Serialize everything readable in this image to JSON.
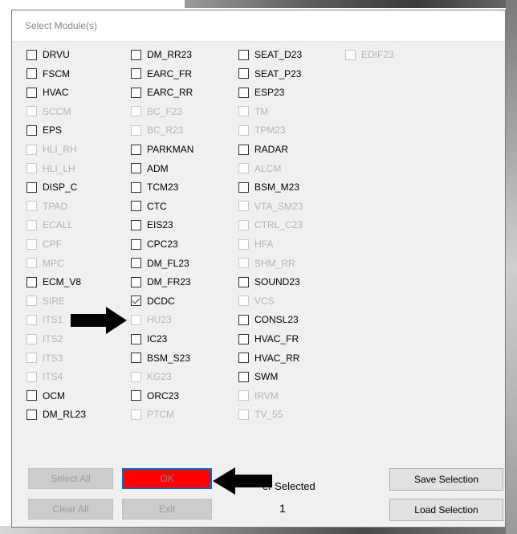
{
  "dialog": {
    "title": "Select Module(s)",
    "columns": [
      [
        {
          "label": "DRVU",
          "enabled": true,
          "checked": false
        },
        {
          "label": "FSCM",
          "enabled": true,
          "checked": false
        },
        {
          "label": "HVAC",
          "enabled": true,
          "checked": false
        },
        {
          "label": "SCCM",
          "enabled": false,
          "checked": false
        },
        {
          "label": "EPS",
          "enabled": true,
          "checked": false
        },
        {
          "label": "HLI_RH",
          "enabled": false,
          "checked": false
        },
        {
          "label": "HLI_LH",
          "enabled": false,
          "checked": false
        },
        {
          "label": "DISP_C",
          "enabled": true,
          "checked": false
        },
        {
          "label": "TPAD",
          "enabled": false,
          "checked": false
        },
        {
          "label": "ECALL",
          "enabled": false,
          "checked": false
        },
        {
          "label": "CPF",
          "enabled": false,
          "checked": false
        },
        {
          "label": "MPC",
          "enabled": false,
          "checked": false
        },
        {
          "label": "ECM_V8",
          "enabled": true,
          "checked": false
        },
        {
          "label": "SIRE",
          "enabled": false,
          "checked": false
        },
        {
          "label": "ITS1",
          "enabled": false,
          "checked": false
        },
        {
          "label": "ITS2",
          "enabled": false,
          "checked": false
        },
        {
          "label": "ITS3",
          "enabled": false,
          "checked": false
        },
        {
          "label": "ITS4",
          "enabled": false,
          "checked": false
        },
        {
          "label": "OCM",
          "enabled": true,
          "checked": false
        },
        {
          "label": "DM_RL23",
          "enabled": true,
          "checked": false
        }
      ],
      [
        {
          "label": "DM_RR23",
          "enabled": true,
          "checked": false
        },
        {
          "label": "EARC_FR",
          "enabled": true,
          "checked": false
        },
        {
          "label": "EARC_RR",
          "enabled": true,
          "checked": false
        },
        {
          "label": "BC_F23",
          "enabled": false,
          "checked": false
        },
        {
          "label": "BC_R23",
          "enabled": false,
          "checked": false
        },
        {
          "label": "PARKMAN",
          "enabled": true,
          "checked": false
        },
        {
          "label": "ADM",
          "enabled": true,
          "checked": false
        },
        {
          "label": "TCM23",
          "enabled": true,
          "checked": false
        },
        {
          "label": "CTC",
          "enabled": true,
          "checked": false
        },
        {
          "label": "EIS23",
          "enabled": true,
          "checked": false
        },
        {
          "label": "CPC23",
          "enabled": true,
          "checked": false
        },
        {
          "label": "DM_FL23",
          "enabled": true,
          "checked": false
        },
        {
          "label": "DM_FR23",
          "enabled": true,
          "checked": false
        },
        {
          "label": "DCDC",
          "enabled": true,
          "checked": true
        },
        {
          "label": "HU23",
          "enabled": false,
          "checked": false
        },
        {
          "label": "IC23",
          "enabled": true,
          "checked": false
        },
        {
          "label": "BSM_S23",
          "enabled": true,
          "checked": false
        },
        {
          "label": "KG23",
          "enabled": false,
          "checked": false
        },
        {
          "label": "ORC23",
          "enabled": true,
          "checked": false
        },
        {
          "label": "PTCM",
          "enabled": false,
          "checked": false
        }
      ],
      [
        {
          "label": "SEAT_D23",
          "enabled": true,
          "checked": false
        },
        {
          "label": "SEAT_P23",
          "enabled": true,
          "checked": false
        },
        {
          "label": "ESP23",
          "enabled": true,
          "checked": false
        },
        {
          "label": "TM",
          "enabled": false,
          "checked": false
        },
        {
          "label": "TPM23",
          "enabled": false,
          "checked": false
        },
        {
          "label": "RADAR",
          "enabled": true,
          "checked": false
        },
        {
          "label": "ALCM",
          "enabled": false,
          "checked": false
        },
        {
          "label": "BSM_M23",
          "enabled": true,
          "checked": false
        },
        {
          "label": "VTA_SM23",
          "enabled": false,
          "checked": false
        },
        {
          "label": "CTRL_C23",
          "enabled": false,
          "checked": false
        },
        {
          "label": "HFA",
          "enabled": false,
          "checked": false
        },
        {
          "label": "SHM_RR",
          "enabled": false,
          "checked": false
        },
        {
          "label": "SOUND23",
          "enabled": true,
          "checked": false
        },
        {
          "label": "VCS",
          "enabled": false,
          "checked": false
        },
        {
          "label": "CONSL23",
          "enabled": true,
          "checked": false
        },
        {
          "label": "HVAC_FR",
          "enabled": true,
          "checked": false
        },
        {
          "label": "HVAC_RR",
          "enabled": true,
          "checked": false
        },
        {
          "label": "SWM",
          "enabled": true,
          "checked": false
        },
        {
          "label": "IRVM",
          "enabled": false,
          "checked": false
        },
        {
          "label": "TV_55",
          "enabled": false,
          "checked": false
        }
      ],
      [
        {
          "label": "EDIF23",
          "enabled": false,
          "checked": false
        }
      ]
    ],
    "buttons": {
      "select_all": "Select All",
      "ok": "OK",
      "clear_all": "Clear All",
      "exit": "Exit",
      "save_selection": "Save Selection",
      "load_selection": "Load Selection"
    },
    "selected_label": "er Selected",
    "selected_count": "1"
  },
  "colors": {
    "ok_fill": "#ff0000",
    "ok_border": "#0a63c7",
    "arrow": "#000000"
  },
  "icons": [
    "arrow-right-icon",
    "arrow-left-icon"
  ]
}
